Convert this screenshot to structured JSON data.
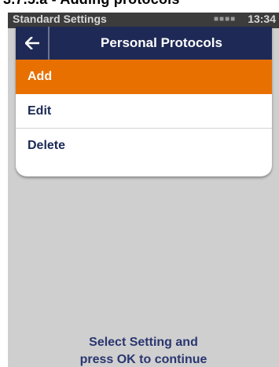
{
  "document": {
    "heading": "3.7.5.a - Adding protocols"
  },
  "status_bar": {
    "title": "Standard Settings",
    "time": "13:34"
  },
  "menu": {
    "title": "Personal Protocols",
    "back_icon": "arrow-left-icon",
    "items": [
      {
        "label": "Add",
        "selected": true
      },
      {
        "label": "Edit",
        "selected": false
      },
      {
        "label": "Delete",
        "selected": false
      }
    ]
  },
  "footer": {
    "line1": "Select Setting and",
    "line2": "press OK to continue"
  },
  "colors": {
    "header": "#1e2a55",
    "selected": "#e87000",
    "text": "#1b2a55",
    "background": "#cfcfcf"
  }
}
